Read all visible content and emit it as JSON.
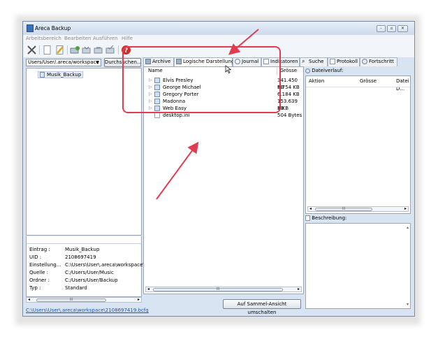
{
  "window": {
    "title": "Areca Backup"
  },
  "menu": [
    "Arbeitsbereich",
    "Bearbeiten",
    "Ausführen",
    "Hilfe"
  ],
  "toolbar": {
    "icons": [
      "settings-icon",
      "new-document-icon",
      "edit-icon",
      "backup-icon",
      "merge-icon",
      "restore-icon",
      "check-icon",
      "help-icon"
    ]
  },
  "workspace": {
    "path": "Users/User/.areca/workspace",
    "browse_label": "Durchsuchen..."
  },
  "tree": {
    "items": [
      {
        "label": "Musik_Backup"
      }
    ]
  },
  "tabs": [
    {
      "label": "Archive",
      "icon": "archive-icon"
    },
    {
      "label": "Logische Darstellung",
      "icon": "logical-view-icon"
    },
    {
      "label": "Journal",
      "icon": "journal-icon"
    },
    {
      "label": "Indikatoren",
      "icon": "indicators-icon"
    },
    {
      "label": "Suche",
      "icon": "search-icon"
    },
    {
      "label": "Protokoll",
      "icon": "log-icon"
    },
    {
      "label": "Fortschritt",
      "icon": "progress-icon"
    }
  ],
  "file_table": {
    "columns": [
      "Name",
      "Grösse"
    ],
    "rows": [
      {
        "name": "Elvis Presley",
        "size": "341.450 KB",
        "type": "folder"
      },
      {
        "name": "George Michael",
        "size": "5.754 KB",
        "type": "folder"
      },
      {
        "name": "Gregory Porter",
        "size": "6.184 KB",
        "type": "folder"
      },
      {
        "name": "Madonna",
        "size": "153.639 KB",
        "type": "folder"
      },
      {
        "name": "Web Easy",
        "size": "1 KB",
        "type": "folder"
      },
      {
        "name": "desktop.ini",
        "size": "504 Bytes",
        "type": "file"
      }
    ]
  },
  "history": {
    "title": "Dateiverlauf:",
    "columns": [
      "Aktion",
      "Grösse",
      "Datei D..."
    ]
  },
  "description": {
    "title": "Beschreibung:"
  },
  "info": [
    {
      "key": "Eintrag :",
      "value": "Musik_Backup"
    },
    {
      "key": "UID :",
      "value": "2108697419"
    },
    {
      "key": "Einstellung...",
      "value": "C:\\Users\\User\\.areca\\workspace\\..."
    },
    {
      "key": "Quelle :",
      "value": "C:/Users/User/Music"
    },
    {
      "key": "Ordner :",
      "value": "C:/Users/User/Backup"
    },
    {
      "key": "Typ :",
      "value": "Standard"
    }
  ],
  "status": {
    "path": "C:\\Users\\User\\.areca\\workspace\\2108697419.bcfg"
  },
  "buttons": {
    "toggle_view": "Auf Sammel-Ansicht umschalten"
  },
  "scroll_grip": "III",
  "colors": {
    "annotation": "#e33c50",
    "link": "#1f55b8",
    "window_frame": "#d8e4f1"
  }
}
